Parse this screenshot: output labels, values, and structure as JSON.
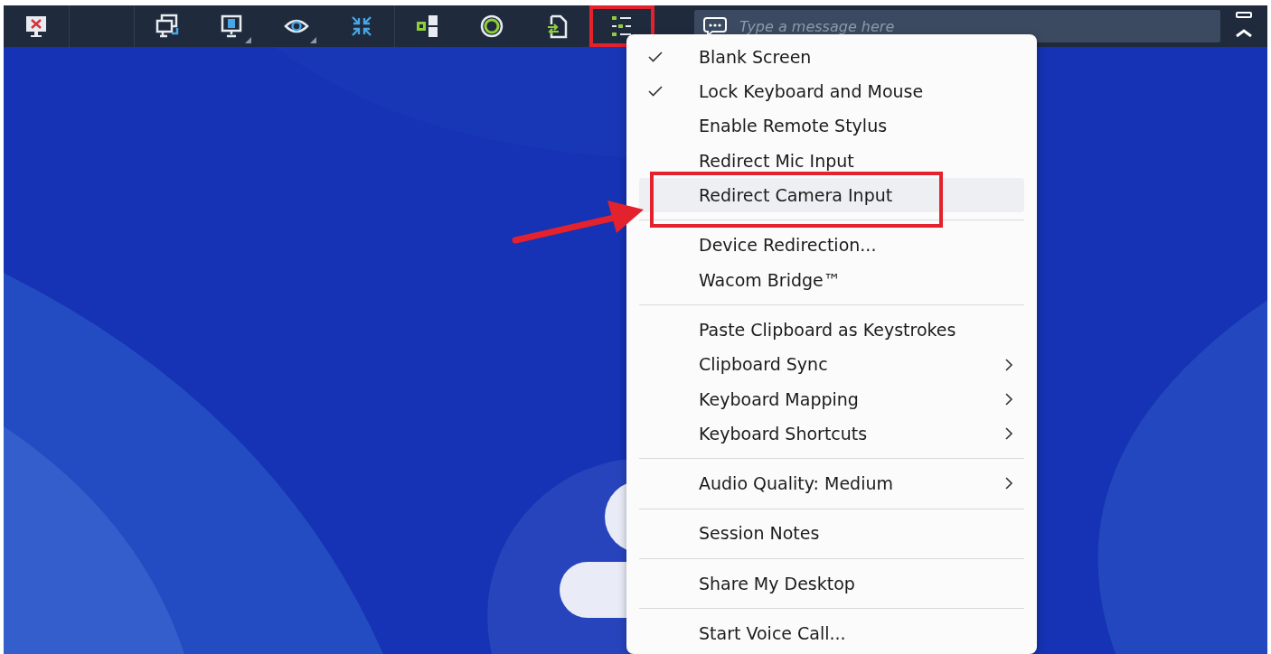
{
  "toolbar": {
    "buttons": [
      {
        "kind": "close-screen",
        "dropdown": false,
        "selected": false
      },
      {
        "kind": "spacer"
      },
      {
        "kind": "switch-screens",
        "dropdown": false,
        "selected": false
      },
      {
        "kind": "monitor",
        "dropdown": true,
        "selected": false
      },
      {
        "kind": "view",
        "dropdown": true,
        "selected": false
      },
      {
        "kind": "shrink",
        "dropdown": false,
        "selected": false
      },
      {
        "kind": "keys",
        "dropdown": false,
        "selected": false
      },
      {
        "kind": "record",
        "dropdown": false,
        "selected": false
      },
      {
        "kind": "file-transfer",
        "dropdown": false,
        "selected": false
      },
      {
        "kind": "actions",
        "dropdown": false,
        "selected": true
      }
    ],
    "message": {
      "placeholder": "Type a message here"
    }
  },
  "menu": {
    "sections": [
      [
        {
          "label": "Blank Screen",
          "checked": true,
          "selected": false,
          "submenu": false
        },
        {
          "label": "Lock Keyboard and Mouse",
          "checked": true,
          "selected": false,
          "submenu": false
        },
        {
          "label": "Enable Remote Stylus",
          "checked": false,
          "selected": false,
          "submenu": false
        },
        {
          "label": "Redirect Mic Input",
          "checked": false,
          "selected": false,
          "submenu": false
        },
        {
          "label": "Redirect Camera Input",
          "checked": false,
          "selected": true,
          "submenu": false
        }
      ],
      [
        {
          "label": "Device Redirection...",
          "checked": false,
          "selected": false,
          "submenu": false
        },
        {
          "label": "Wacom Bridge™",
          "checked": false,
          "selected": false,
          "submenu": false
        }
      ],
      [
        {
          "label": "Paste Clipboard as Keystrokes",
          "checked": false,
          "selected": false,
          "submenu": false
        },
        {
          "label": "Clipboard Sync",
          "checked": false,
          "selected": false,
          "submenu": true
        },
        {
          "label": "Keyboard Mapping",
          "checked": false,
          "selected": false,
          "submenu": true
        },
        {
          "label": "Keyboard Shortcuts",
          "checked": false,
          "selected": false,
          "submenu": true
        }
      ],
      [
        {
          "label": "Audio Quality: Medium",
          "checked": false,
          "selected": false,
          "submenu": true
        }
      ],
      [
        {
          "label": "Session Notes",
          "checked": false,
          "selected": false,
          "submenu": false
        }
      ],
      [
        {
          "label": "Share My Desktop",
          "checked": false,
          "selected": false,
          "submenu": false
        }
      ],
      [
        {
          "label": "Start Voice Call...",
          "checked": false,
          "selected": false,
          "submenu": false
        }
      ]
    ]
  }
}
